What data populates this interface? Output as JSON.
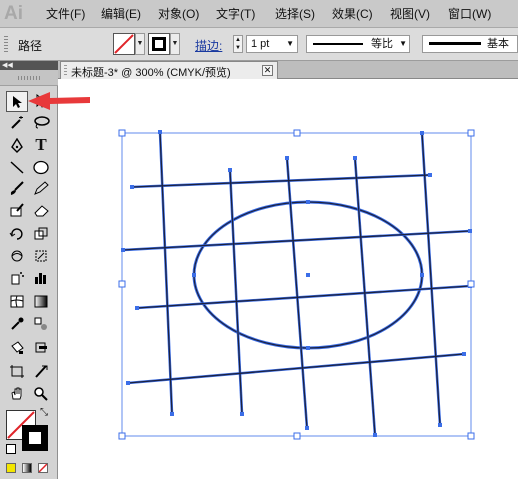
{
  "app": {
    "logo": "Ai"
  },
  "menu": [
    "文件(F)",
    "编辑(E)",
    "对象(O)",
    "文字(T)",
    "选择(S)",
    "效果(C)",
    "视图(V)",
    "窗口(W)"
  ],
  "control_bar": {
    "selection_type": "路径",
    "stroke_label": "描边:",
    "stroke_weight": "1 pt",
    "profile_label": "等比",
    "brush_label": "基本"
  },
  "tools_panel": {
    "collapse_label": "◀◀"
  },
  "document": {
    "tab_title": "未标题-3* @ 300% (CMYK/预览)",
    "close_glyph": "✕"
  },
  "colors": {
    "selection": "#3b6ee8",
    "path": "#1c2240",
    "annotation_arrow": "#e8393a"
  },
  "icons": [
    "selection-arrow",
    "direct-selection",
    "magic-wand",
    "lasso",
    "pen",
    "type",
    "line-segment",
    "ellipse",
    "paintbrush",
    "pencil",
    "blob-brush",
    "eraser",
    "rotate",
    "scale",
    "warp",
    "free-transform",
    "symbol-sprayer",
    "column-graph",
    "mesh",
    "gradient",
    "eyedropper",
    "blend",
    "live-paint-bucket",
    "live-paint-selection",
    "artboard",
    "slice",
    "hand",
    "zoom",
    "fill-stroke",
    "swap",
    "default-colors",
    "color-mode",
    "gradient-mode",
    "none-mode",
    "screen-mode"
  ]
}
